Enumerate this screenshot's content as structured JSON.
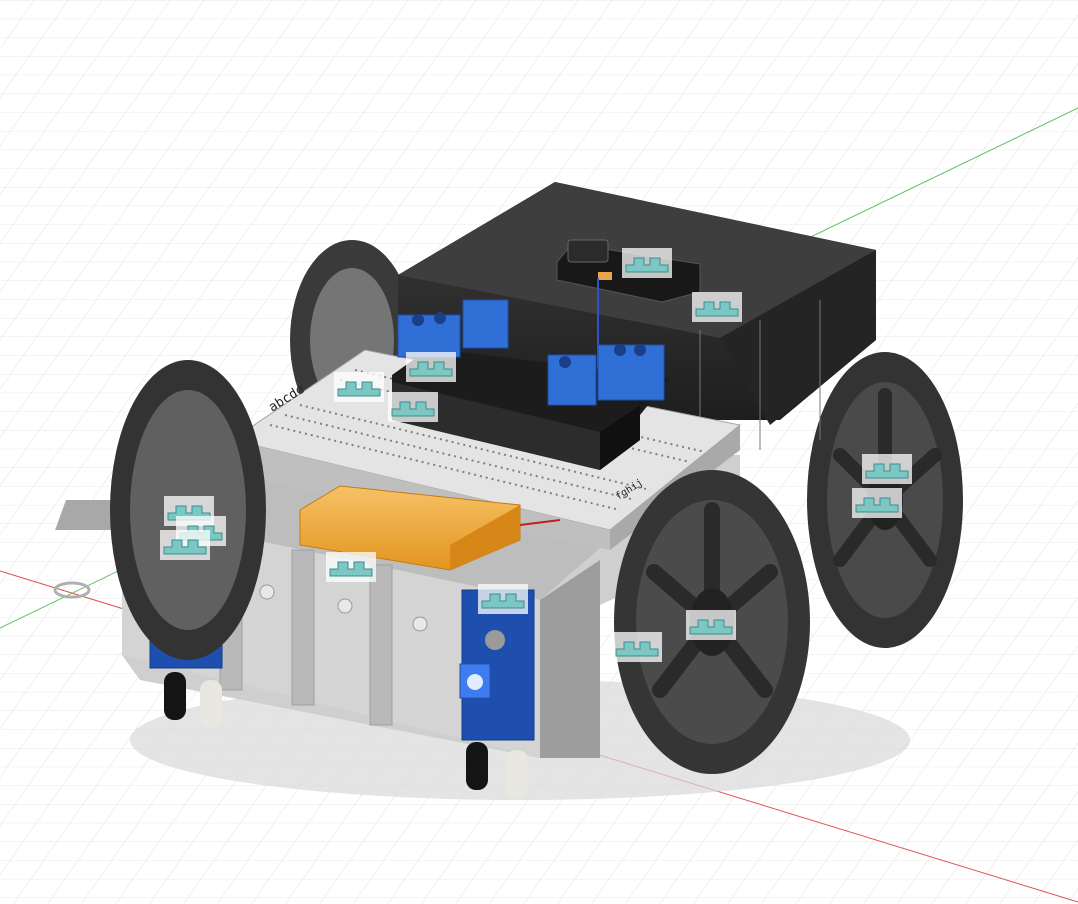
{
  "app": {
    "view": "3D viewport",
    "model": "robot-chassis-assembly"
  },
  "colors": {
    "background": "#ffffff",
    "grid": "#dcdcdc",
    "x_axis": "#e05050",
    "y_axis": "#60c060",
    "chassis": "#c8c8c8",
    "enclosure": "#2a2a2a",
    "wheel": "#3a3a3a",
    "terminal_block": "#2f6fd6",
    "sensor_board": "#1f4fae",
    "battery": "#f0a830",
    "joint_glyph": "#7ac7c4"
  },
  "icons": {
    "joint_marker": "joint-icon",
    "origin": "origin-icon"
  },
  "labels": {
    "breadboard_markings": [
      "abcde",
      "fghij"
    ]
  }
}
